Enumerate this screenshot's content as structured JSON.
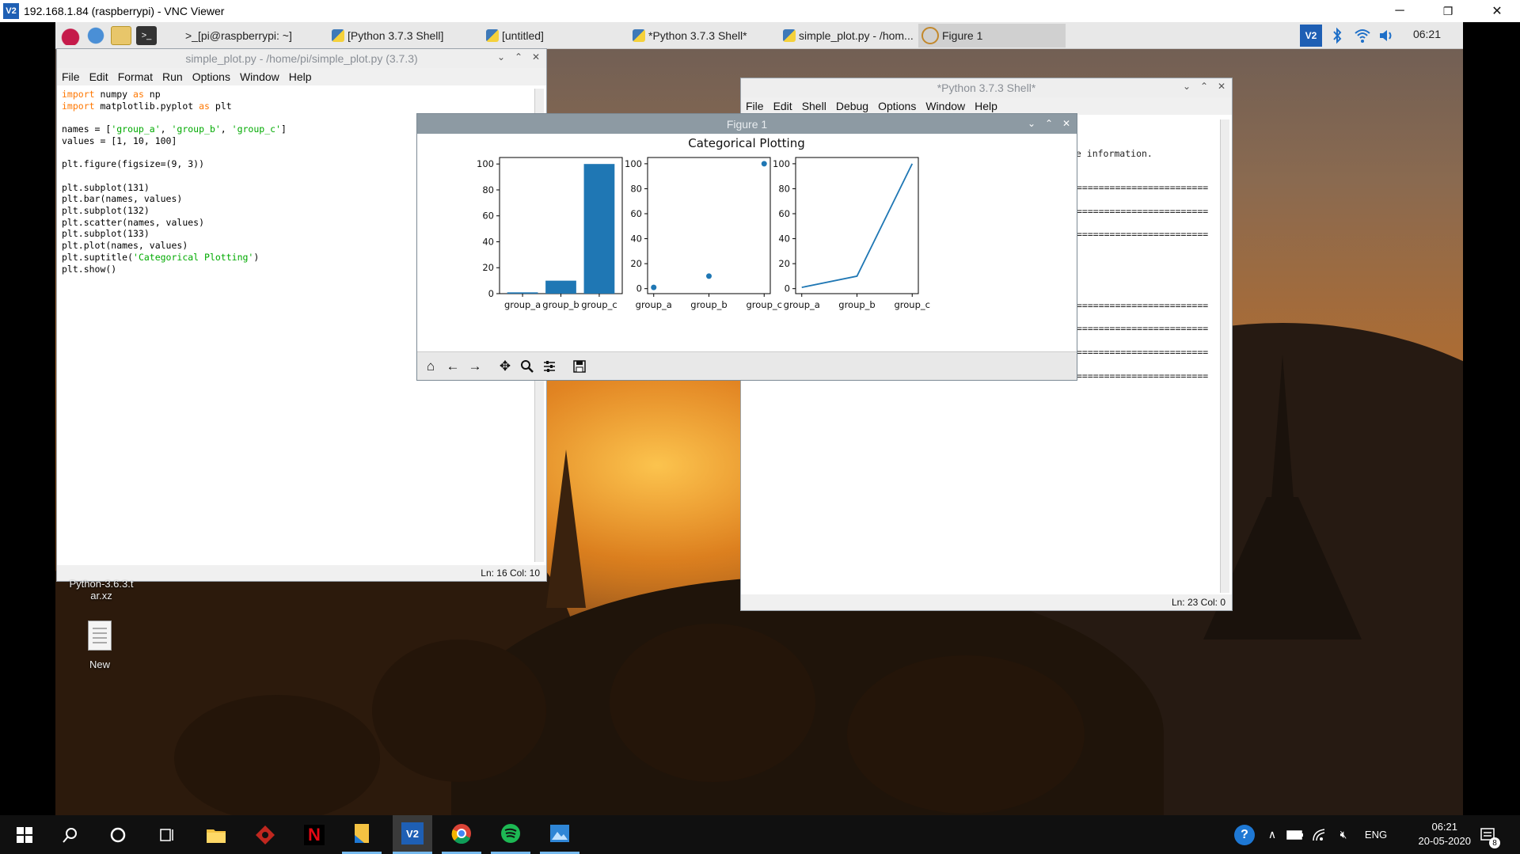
{
  "vnc": {
    "logo": "V2",
    "title": "192.168.1.84 (raspberrypi) - VNC Viewer",
    "minimize": "─",
    "restore": "❐",
    "close": "✕"
  },
  "panel": {
    "terminal_label": ">_",
    "tasks": [
      {
        "label": ">_[pi@raspberrypi: ~]"
      },
      {
        "label": "[Python 3.7.3 Shell]"
      },
      {
        "label": "[untitled]"
      },
      {
        "label": "*Python 3.7.3 Shell*"
      },
      {
        "label": "simple_plot.py - /hom..."
      },
      {
        "label": "Figure 1"
      }
    ],
    "clock": "06:21"
  },
  "editor": {
    "title": "simple_plot.py - /home/pi/simple_plot.py (3.7.3)",
    "menu": [
      "File",
      "Edit",
      "Format",
      "Run",
      "Options",
      "Window",
      "Help"
    ],
    "status": "Ln: 16  Col: 10",
    "code_lines": [
      "import numpy as np",
      "import matplotlib.pyplot as plt",
      "",
      "names = ['group_a', 'group_b', 'group_c']",
      "values = [1, 10, 100]",
      "",
      "plt.figure(figsize=(9, 3))",
      "",
      "plt.subplot(131)",
      "plt.bar(names, values)",
      "plt.subplot(132)",
      "plt.scatter(names, values)",
      "plt.subplot(133)",
      "plt.plot(names, values)",
      "plt.suptitle('Categorical Plotting')",
      "plt.show()"
    ]
  },
  "shell": {
    "title": "*Python 3.7.3 Shell*",
    "menu": [
      "File",
      "Edit",
      "Shell",
      "Debug",
      "Options",
      "Window",
      "Help"
    ],
    "info_text": "re information.",
    "separator": "========================",
    "status": "Ln: 23  Col: 0"
  },
  "figure": {
    "window_title": "Figure 1",
    "toolbar": [
      "home-icon",
      "back-icon",
      "forward-icon",
      "pan-icon",
      "zoom-icon",
      "configure-icon",
      "save-icon"
    ]
  },
  "chart_data": {
    "title": "Categorical Plotting",
    "subplots": [
      {
        "type": "bar",
        "categories": [
          "group_a",
          "group_b",
          "group_c"
        ],
        "values": [
          1,
          10,
          100
        ],
        "ylim": [
          0,
          105
        ],
        "yticks": [
          0,
          20,
          40,
          60,
          80,
          100
        ],
        "color": "#1f77b4"
      },
      {
        "type": "scatter",
        "categories": [
          "group_a",
          "group_b",
          "group_c"
        ],
        "values": [
          1,
          10,
          100
        ],
        "ylim": [
          -4,
          105
        ],
        "yticks": [
          0,
          20,
          40,
          60,
          80,
          100
        ],
        "color": "#1f77b4"
      },
      {
        "type": "line",
        "categories": [
          "group_a",
          "group_b",
          "group_c"
        ],
        "values": [
          1,
          10,
          100
        ],
        "ylim": [
          -4,
          105
        ],
        "yticks": [
          0,
          20,
          40,
          60,
          80,
          100
        ],
        "color": "#1f77b4"
      }
    ]
  },
  "desktop": {
    "file1_label": "Python-3.6.3.t\nar.xz",
    "file2_label": "New"
  },
  "taskbar": {
    "date": "20-05-2020",
    "time": "06:21",
    "lang": "ENG",
    "notif_count": "8"
  }
}
